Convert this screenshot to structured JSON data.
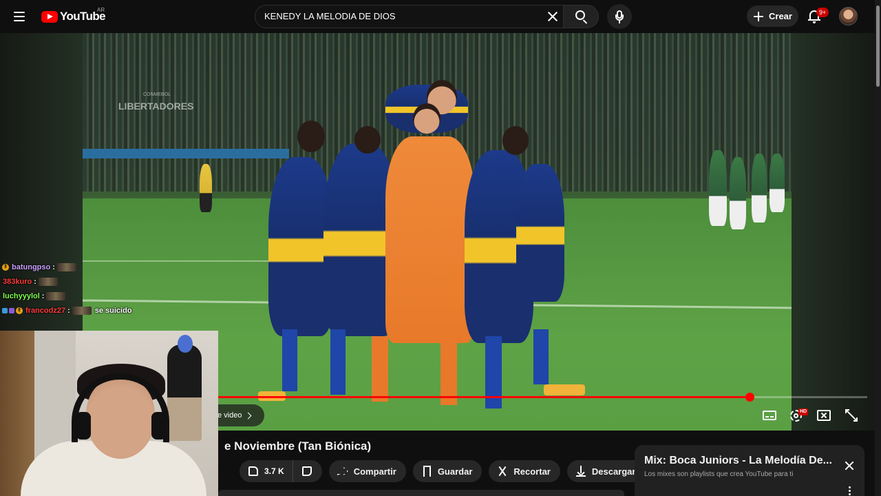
{
  "header": {
    "logo_text": "YouTube",
    "country_code": "AR",
    "search_value": "KENEDY LA MELODIA DE DIOS",
    "create_label": "Crear",
    "notification_badge": "9+"
  },
  "video": {
    "watermark_small": "CONMEBOL",
    "watermark_main": "LIBERTADORES",
    "progress_fraction": 0.82,
    "next_video_label": "e video",
    "hd_badge": "HD"
  },
  "chat": [
    {
      "user": "batungpso",
      "user_color": "#c9a0ff",
      "badges": [
        "gold"
      ],
      "message": ""
    },
    {
      "user": "383kuro",
      "user_color": "#ff3b3b",
      "badges": [],
      "message": ""
    },
    {
      "user": "luchyyylol",
      "user_color": "#7cff4a",
      "badges": [],
      "message": ""
    },
    {
      "user": "francodz27",
      "user_color": "#ff3b3b",
      "badges": [
        "blue",
        "purple",
        "gold"
      ],
      "message": "se suicido"
    }
  ],
  "below_video": {
    "title": "e Noviembre (Tan Biónica)",
    "like_count": "3.7 K",
    "share_label": "Compartir",
    "save_label": "Guardar",
    "clip_label": "Recortar",
    "download_label": "Descargar"
  },
  "mix": {
    "title": "Mix: Boca Juniors - La Melodía De...",
    "subtitle": "Los mixes son playlists que crea YouTube para ti"
  },
  "colors": {
    "accent": "#ff0000",
    "background": "#0f0f0f",
    "pill": "#272727"
  }
}
